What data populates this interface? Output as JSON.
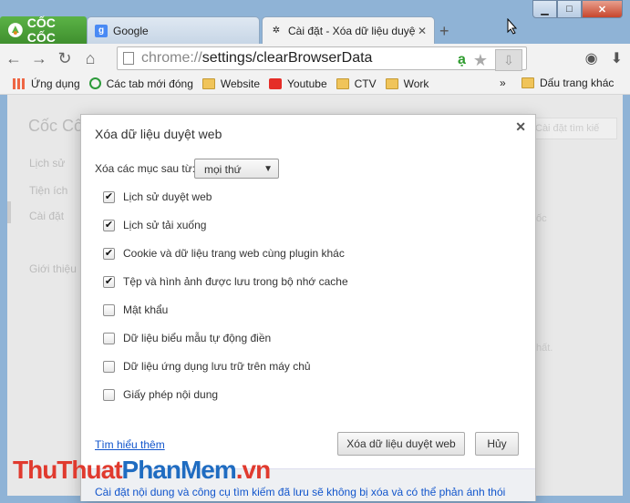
{
  "window": {
    "controls": {
      "minimize": "▁",
      "maximize": "□",
      "close": "✕"
    }
  },
  "brand": {
    "name": "CỐC CỐC"
  },
  "tabs": [
    {
      "title": "Google",
      "icon": "google-icon"
    },
    {
      "title": "Cài đặt - Xóa dữ liệu duyệt",
      "icon": "gear-icon",
      "active": true
    }
  ],
  "tab_close": "✕",
  "new_tab": "+",
  "toolbar": {
    "url_scheme": "chrome://",
    "url_rest": "settings/clearBrowserData",
    "omni_letter": "ạ"
  },
  "bookmarks": {
    "items": [
      {
        "label": "Ứng dụng",
        "icon": "apps-icon"
      },
      {
        "label": "Các tab mới đóng",
        "icon": "history-icon"
      },
      {
        "label": "Website",
        "icon": "folder-icon"
      },
      {
        "label": "Youtube",
        "icon": "youtube-icon"
      },
      {
        "label": "CTV",
        "icon": "folder-icon"
      },
      {
        "label": "Work",
        "icon": "folder-icon"
      }
    ],
    "more": "»",
    "other": "Dấu trang khác"
  },
  "page": {
    "sidebar_title": "Cốc Cố",
    "side_items": [
      "Lịch sử",
      "Tiện ích",
      "Cài đặt",
      "Giới thiệu"
    ],
    "search_placeholder": "Cài đặt tìm kiế",
    "faint_right_1": "ốc",
    "faint_right_2": "hất."
  },
  "dialog": {
    "title": "Xóa dữ liệu duyệt web",
    "close": "✕",
    "clear_from_label": "Xóa các mục sau từ:",
    "period_selected": "mọi thứ",
    "options": [
      {
        "label": "Lịch sử duyệt web",
        "checked": true
      },
      {
        "label": "Lịch sử tải xuống",
        "checked": true
      },
      {
        "label": "Cookie và dữ liệu trang web cùng plugin khác",
        "checked": true
      },
      {
        "label": "Tệp và hình ảnh được lưu trong bộ nhớ cache",
        "checked": true
      },
      {
        "label": "Mật khẩu",
        "checked": false
      },
      {
        "label": "Dữ liệu biểu mẫu tự động điền",
        "checked": false
      },
      {
        "label": "Dữ liệu ứng dụng lưu trữ trên máy chủ",
        "checked": false
      },
      {
        "label": "Giấy phép nội dung",
        "checked": false
      }
    ],
    "learn_more": "Tìm hiểu thêm",
    "clear_button": "Xóa dữ liệu duyệt web",
    "cancel_button": "Hủy",
    "footer_text": "Cài đặt nội dung và công cụ tìm kiếm đã lưu sẽ không bị xóa và có thể phản ánh thói"
  },
  "watermark": {
    "part1": "ThuThuat",
    "part2": "PhanMem",
    "part3": ".vn"
  },
  "colors": {
    "accent": "#1155cc",
    "brand_green": "#4caf3a",
    "watermark_red": "#e03a2e",
    "watermark_blue": "#1f6cc1"
  }
}
